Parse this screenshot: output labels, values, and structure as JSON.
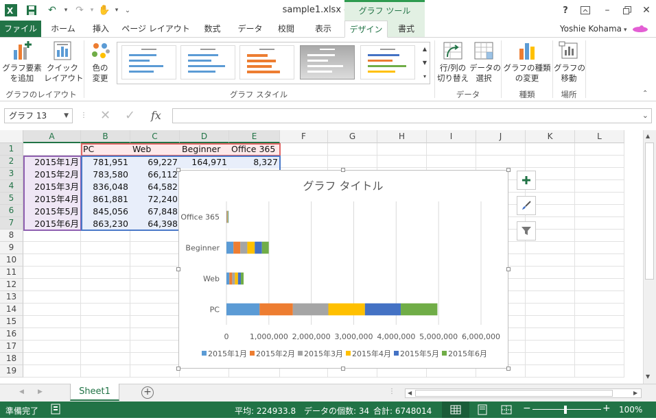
{
  "window": {
    "title": "sample1.xlsx - Excel",
    "tools_tab_group": "グラフ ツール",
    "help": "?",
    "user": "Yoshie Kohama"
  },
  "tabs": [
    {
      "label": "ファイル"
    },
    {
      "label": "ホーム"
    },
    {
      "label": "挿入"
    },
    {
      "label": "ページ レイアウト"
    },
    {
      "label": "数式"
    },
    {
      "label": "データ"
    },
    {
      "label": "校閲"
    },
    {
      "label": "表示"
    },
    {
      "label": "デザイン"
    },
    {
      "label": "書式"
    }
  ],
  "ribbon": {
    "add_element": "グラフ要素\nを追加",
    "quick_layout": "クイック\nレイアウト",
    "layout_group": "グラフのレイアウト",
    "change_colors": "色の\n変更",
    "style_group": "グラフ スタイル",
    "switch_row_col": "行/列の\n切り替え",
    "select_data": "データの\n選択",
    "data_group": "データ",
    "change_type": "グラフの種類\nの変更",
    "type_group": "種類",
    "move_chart": "グラフの\n移動",
    "location_group": "場所"
  },
  "formula_bar": {
    "name_box": "グラフ 13",
    "fx": "fx",
    "value": ""
  },
  "columns": [
    "A",
    "B",
    "C",
    "D",
    "E",
    "F",
    "G",
    "H",
    "I",
    "J",
    "K",
    "L"
  ],
  "rows": [
    "1",
    "2",
    "3",
    "4",
    "5",
    "6",
    "7",
    "8",
    "9",
    "10",
    "11",
    "12",
    "13",
    "14",
    "15",
    "16",
    "17",
    "18",
    "19"
  ],
  "cells": {
    "header": [
      "PC",
      "Web",
      "Beginner",
      "Office 365"
    ],
    "data": [
      {
        "month": "2015年1月",
        "pc": "781,951",
        "web": "69,227",
        "beginner": "164,971",
        "office": "8,327"
      },
      {
        "month": "2015年2月",
        "pc": "783,580",
        "web": "66,112"
      },
      {
        "month": "2015年3月",
        "pc": "836,048",
        "web": "64,582"
      },
      {
        "month": "2015年4月",
        "pc": "861,881",
        "web": "72,240"
      },
      {
        "month": "2015年5月",
        "pc": "845,056",
        "web": "67,848"
      },
      {
        "month": "2015年6月",
        "pc": "863,230",
        "web": "64,398"
      }
    ]
  },
  "chart_data": {
    "type": "bar",
    "stacked": true,
    "orientation": "horizontal",
    "title": "グラフ タイトル",
    "categories": [
      "PC",
      "Web",
      "Beginner",
      "Office 365"
    ],
    "series": [
      {
        "name": "2015年1月",
        "color": "#5b9bd5",
        "values": [
          781951,
          69227,
          164971,
          8327
        ]
      },
      {
        "name": "2015年2月",
        "color": "#ed7d31",
        "values": [
          783580,
          66112,
          162000,
          8300
        ]
      },
      {
        "name": "2015年3月",
        "color": "#a5a5a5",
        "values": [
          836048,
          64582,
          165000,
          8500
        ]
      },
      {
        "name": "2015年4月",
        "color": "#ffc000",
        "values": [
          861881,
          72240,
          175000,
          8700
        ]
      },
      {
        "name": "2015年5月",
        "color": "#4472c4",
        "values": [
          845056,
          67848,
          170000,
          8600
        ]
      },
      {
        "name": "2015年6月",
        "color": "#70ad47",
        "values": [
          863230,
          64398,
          160000,
          8400
        ]
      }
    ],
    "xlim": [
      0,
      6000000
    ],
    "xticks": [
      "0",
      "1,000,000",
      "2,000,000",
      "3,000,000",
      "4,000,000",
      "5,000,000",
      "6,000,000"
    ],
    "gridlines": true,
    "legend": "bottom"
  },
  "sheets": [
    "Sheet1"
  ],
  "status": {
    "ready": "準備完了",
    "average": "平均: 224933.8",
    "count": "データの個数: 34",
    "sum": "合計: 6748014",
    "zoom": "100%"
  }
}
